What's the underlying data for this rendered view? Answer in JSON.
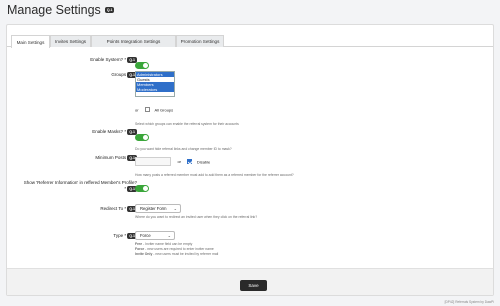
{
  "page": {
    "title": "Manage Settings",
    "help_badge": "Q.1"
  },
  "tabs": [
    {
      "label": "Main Settings",
      "active": true
    },
    {
      "label": "Invites Settings",
      "active": false
    },
    {
      "label": "Points Integration Settings",
      "active": false
    },
    {
      "label": "Promotion Settings",
      "active": false
    }
  ],
  "settings": {
    "enable_system": {
      "label": "Enable System? *",
      "badge": "Q.1",
      "value": true
    },
    "groups": {
      "label": "Groups",
      "badge": "Q.1",
      "options": [
        "Administrators",
        "Guests",
        "Members",
        "Moderators"
      ],
      "selected": [
        "Administrators",
        "Members",
        "Moderators"
      ],
      "or_text": "or",
      "all_groups_label": "All Groups",
      "all_groups_checked": false,
      "hint": "Select which groups can enable the referral system for their accounts"
    },
    "enable_masks": {
      "label": "Enable Masks? *",
      "badge": "Q.1",
      "value": true,
      "hint": "Do you want hide referral links and change member ID to mask?"
    },
    "minimum_posts": {
      "label": "Minimum Posts",
      "badge": "Q.1",
      "value": "",
      "or_text": "or",
      "disable_label": "Disable",
      "disable_checked": true,
      "hint": "How many posts a referred member must add to add them as a referred member for the referrer account?"
    },
    "show_referrer": {
      "label": "Show 'Referrer Information' in reffered Member's Profile? *",
      "badge": "Q.1",
      "value": true
    },
    "redirect_to": {
      "label": "Redirect To *",
      "badge": "Q.1",
      "value": "Register Form",
      "hint": "Where do you want to redirect an invited user when they click on the referral link?"
    },
    "type": {
      "label": "Type *",
      "badge": "Q.1",
      "value": "Force",
      "hints": [
        {
          "term": "Free",
          "text": " - Inviter name field can be empty"
        },
        {
          "term": "Force",
          "text": " - new users are required to enter inviter name"
        },
        {
          "term": "Invite Only",
          "text": " - new users must be invited by referrer mail"
        }
      ]
    }
  },
  "footer": {
    "save_label": "Save"
  },
  "copyright": "[DP42] Referrals System by DawPi"
}
